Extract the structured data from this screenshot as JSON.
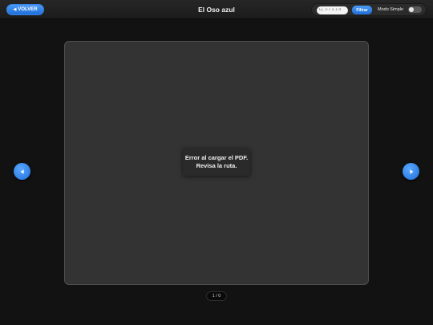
{
  "header": {
    "back_label": "VOLVER",
    "title": "El Oso azul"
  },
  "filter": {
    "input_placeholder": "Ej: 3-7 o 1-4",
    "button_label": "Filtrar"
  },
  "mode": {
    "label": "Modo Simple",
    "enabled": false
  },
  "viewer": {
    "error_line1": "Error al cargar el PDF.",
    "error_line2": "Revisa la ruta."
  },
  "pagination": {
    "indicator": "1 / 0"
  },
  "colors": {
    "accent": "#2a7fe8",
    "background": "#121212",
    "viewer_bg": "#333333"
  },
  "icons": {
    "back": "triangle-left-icon",
    "prev": "chevron-left-icon",
    "next": "chevron-right-icon"
  }
}
